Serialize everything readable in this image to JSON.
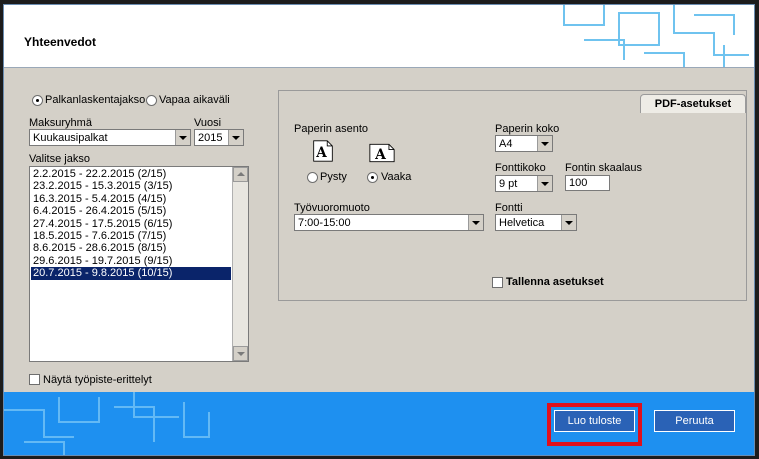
{
  "window": {
    "title": "Yhteenvedot"
  },
  "period_mode": {
    "payroll_label": "Palkanlaskentajakso",
    "payroll_selected": true,
    "free_label": "Vapaa aikaväli",
    "free_selected": false
  },
  "salary_group": {
    "label": "Maksuryhmä",
    "value": "Kuukausipalkat"
  },
  "year": {
    "label": "Vuosi",
    "value": "2015"
  },
  "period_list": {
    "label": "Valitse jakso",
    "items": [
      "2.2.2015 - 22.2.2015 (2/15)",
      "23.2.2015 - 15.3.2015 (3/15)",
      "16.3.2015 - 5.4.2015 (4/15)",
      "6.4.2015 - 26.4.2015 (5/15)",
      "27.4.2015 - 17.5.2015 (6/15)",
      "18.5.2015 - 7.6.2015 (7/15)",
      "8.6.2015 - 28.6.2015 (8/15)",
      "29.6.2015 - 19.7.2015 (9/15)",
      "20.7.2015 - 9.8.2015 (10/15)"
    ],
    "selected_index": 8
  },
  "show_workplace": {
    "label": "Näytä työpiste-erittelyt",
    "checked": false
  },
  "pdf": {
    "tab_label": "PDF-asetukset",
    "orientation_label": "Paperin asento",
    "portrait_label": "Pysty",
    "landscape_label": "Vaaka",
    "icon_letter": "A",
    "paper_size_label": "Paperin koko",
    "paper_size_value": "A4",
    "font_size_label": "Fonttikoko",
    "font_size_value": "9 pt",
    "font_scale_label": "Fontin skaalaus",
    "font_scale_value": "100",
    "shift_format_label": "Työvuoromuoto",
    "shift_format_value": "7:00-15:00",
    "font_label": "Fontti",
    "font_value": "Helvetica",
    "save_settings_label": "Tallenna asetukset"
  },
  "footer": {
    "create_label": "Luo tuloste",
    "cancel_label": "Peruuta"
  },
  "colors": {
    "footer_bg": "#1e90f0",
    "button_bg": "#2a62b6",
    "highlight": "#e0101c",
    "selection": "#0a246a"
  }
}
